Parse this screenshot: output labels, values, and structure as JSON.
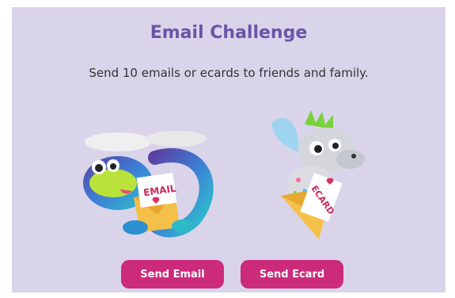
{
  "challenge": {
    "title": "Email Challenge",
    "description": "Send 10 emails or ecards to friends and family."
  },
  "illustrations": {
    "dragon_envelope_label": "EMAIL",
    "critter_envelope_label": "ECARD"
  },
  "actions": {
    "send_email_label": "Send Email",
    "send_ecard_label": "Send Ecard"
  },
  "colors": {
    "background": "#d9d4ea",
    "title": "#6a55a8",
    "button": "#cc2a7a"
  }
}
